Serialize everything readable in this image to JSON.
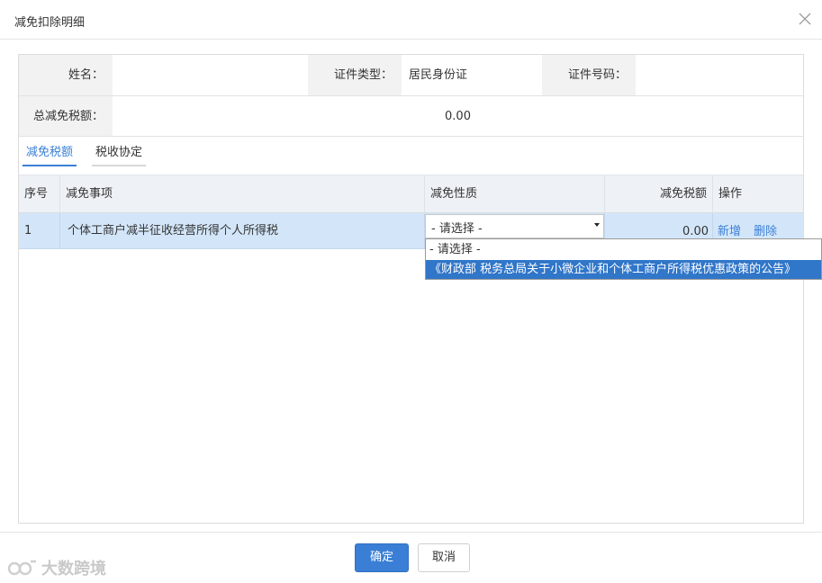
{
  "dialog": {
    "title": "减免扣除明细",
    "close_icon": "close-icon"
  },
  "info": {
    "name_label": "姓名：",
    "name_value": "",
    "id_type_label": "证件类型：",
    "id_type_value": "居民身份证",
    "id_number_label": "证件号码：",
    "id_number_value": "",
    "total_label": "总减免税额：",
    "total_value": "0.00"
  },
  "tabs": [
    {
      "label": "减免税额",
      "active": true
    },
    {
      "label": "税收协定",
      "active": false
    }
  ],
  "table": {
    "columns": [
      "序号",
      "减免事项",
      "减免性质",
      "减免税额",
      "操作"
    ],
    "rows": [
      {
        "index": "1",
        "item": "个体工商户减半征收经营所得个人所得税",
        "nature": "- 请选择 -",
        "amount": "0.00",
        "actions": [
          "新增",
          "删除"
        ]
      }
    ]
  },
  "dropdown": {
    "options": [
      "- 请选择 -",
      "《财政部 税务总局关于小微企业和个体工商户所得税优惠政策的公告》"
    ],
    "highlighted_index": 1
  },
  "footer": {
    "ok_label": "确定",
    "cancel_label": "取消"
  },
  "watermark": {
    "text": "大数跨境",
    "icon": "watermark-logo-icon"
  },
  "colors": {
    "accent": "#3a7fd5",
    "row_selected": "#d3e6f9",
    "dropdown_highlight": "#3076c9"
  }
}
